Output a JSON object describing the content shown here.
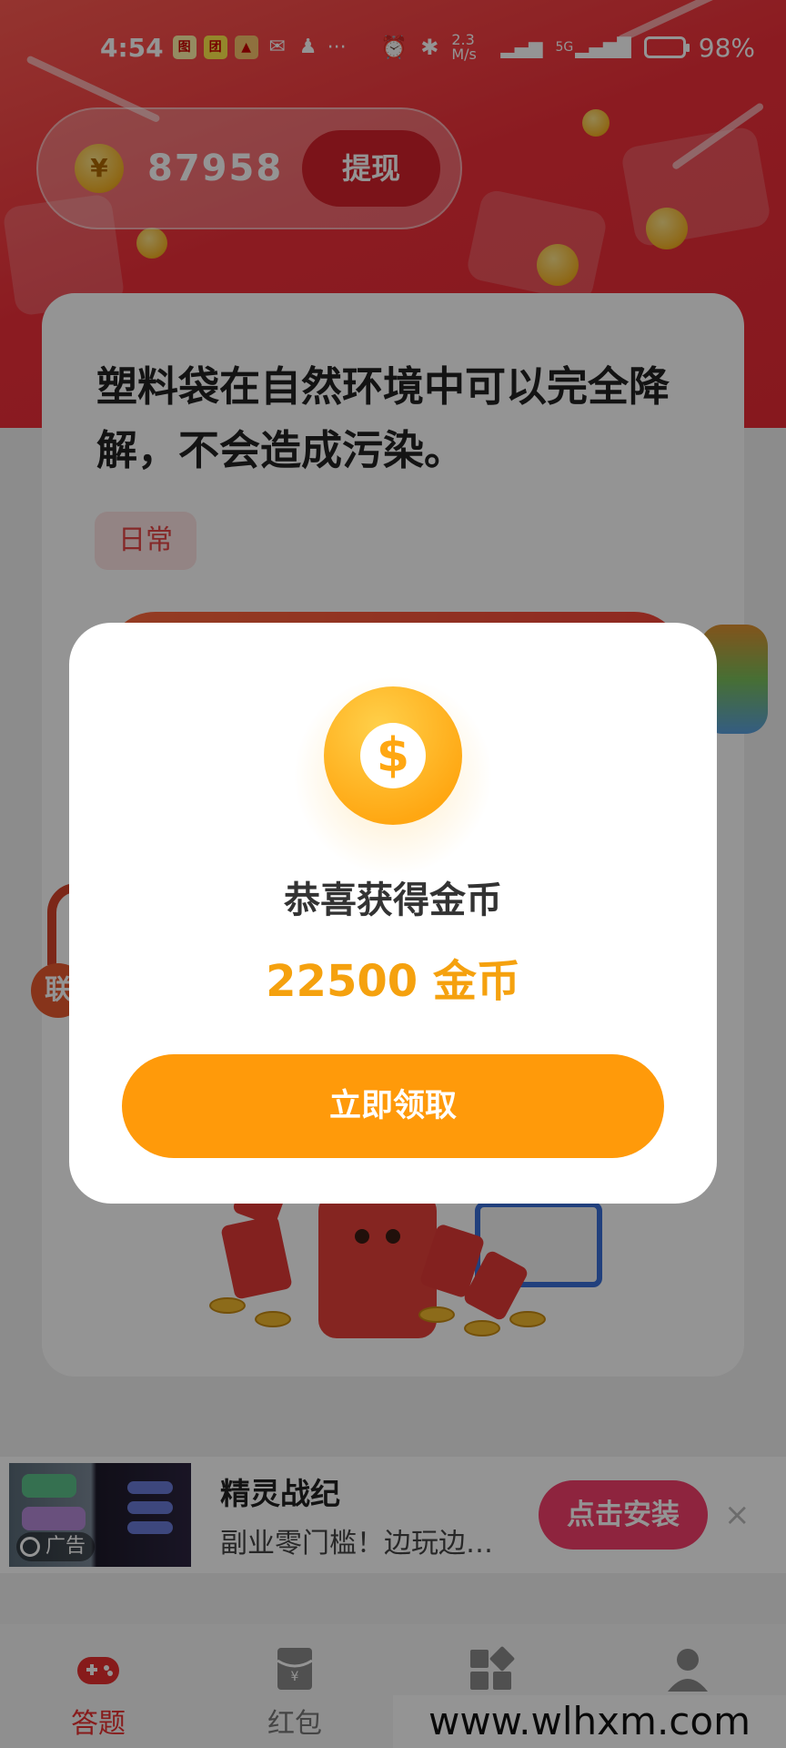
{
  "status_bar": {
    "time": "4:54",
    "network_speed": "2.3 M/s",
    "signal_label": "5G",
    "battery": "98%"
  },
  "balance": {
    "amount": "87958",
    "withdraw_label": "提现"
  },
  "question": {
    "text": "塑料袋在自然环境中可以完全降解，不会造成污染。",
    "tag": "日常"
  },
  "side_badge": "联",
  "modal": {
    "title": "恭喜获得金币",
    "reward": "22500 金币",
    "claim_label": "立即领取"
  },
  "ad": {
    "label": "广告",
    "title": "精灵战纪",
    "description": "副业零门槛！边玩边…",
    "install_label": "点击安装",
    "close_symbol": "×"
  },
  "tabs": [
    {
      "label": "答题",
      "icon": "gamepad-icon",
      "active": true
    },
    {
      "label": "红包",
      "icon": "red-envelope-icon",
      "active": false
    },
    {
      "label": "",
      "icon": "grid-apps-icon",
      "active": false
    },
    {
      "label": "",
      "icon": "user-icon",
      "active": false
    }
  ],
  "watermark": "www.wlhxm.com",
  "colors": {
    "hero_red": "#f0303a",
    "accent_orange": "#ff9a0a",
    "reward_orange": "#f5a10e",
    "install_pink": "#f43f6b"
  }
}
